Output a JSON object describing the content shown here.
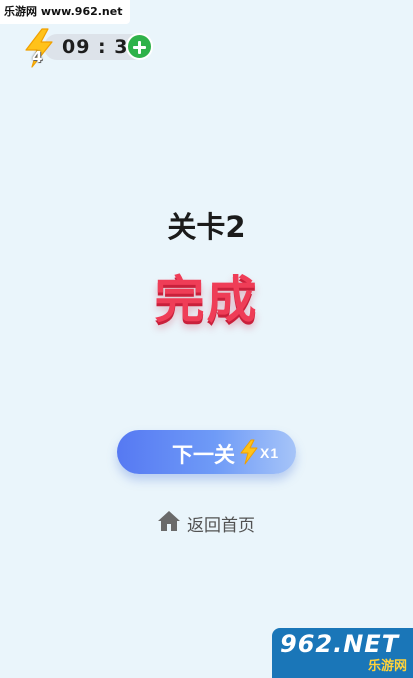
{
  "watermark": {
    "top": "乐游网 www.962.net",
    "bottom_main": "962.NET",
    "bottom_sub": "乐游网"
  },
  "status": {
    "energy_count": "4",
    "timer": "09 : 39"
  },
  "level": {
    "title": "关卡2",
    "result": "完成"
  },
  "actions": {
    "next_label": "下一关",
    "next_cost": "X1",
    "home_label": "返回首页"
  },
  "icons": {
    "energy": "lightning-bolt-icon",
    "add": "plus-icon",
    "home": "home-icon"
  },
  "colors": {
    "accent_red": "#ef3d57",
    "button_blue": "#5679f2",
    "bolt_yellow": "#ffc21a",
    "plus_green": "#2fb24a",
    "background": "#eaf5fb"
  }
}
